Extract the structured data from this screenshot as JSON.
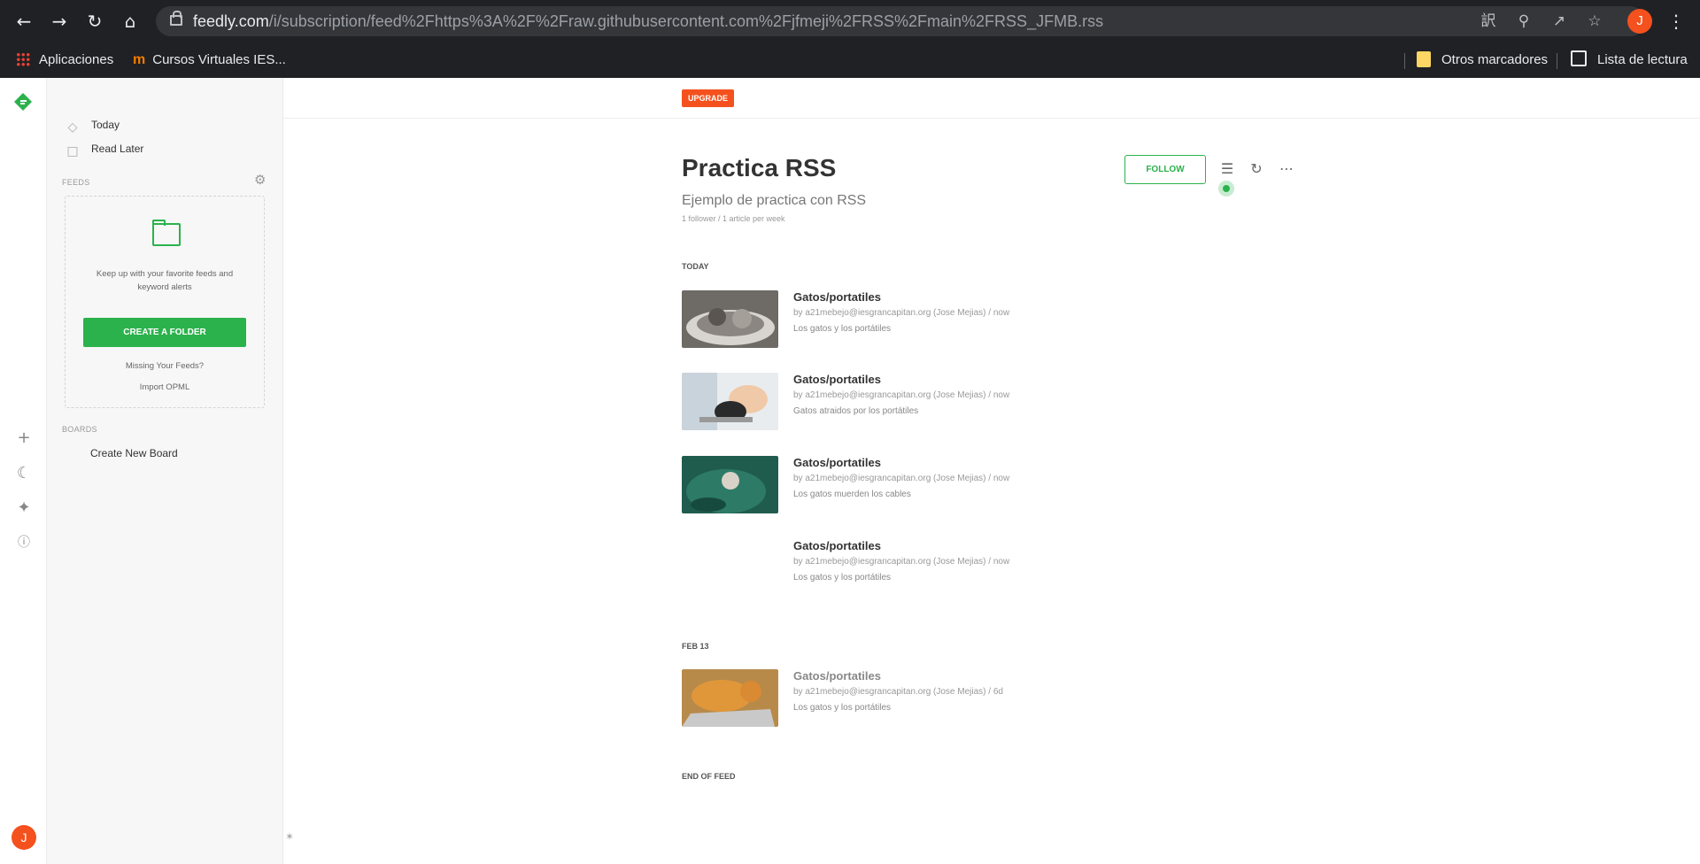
{
  "browser": {
    "url_host": "feedly.com",
    "url_path": "/i/subscription/feed%2Fhttps%3A%2F%2Fraw.githubusercontent.com%2Fjfmeji%2FRSS%2Fmain%2FRSS_JFMB.rss",
    "profile_initial": "J",
    "bookmarks": {
      "apps": "Aplicaciones",
      "cursos": "Cursos Virtuales IES...",
      "others": "Otros marcadores",
      "reading_list": "Lista de lectura"
    }
  },
  "rail": {
    "avatar_initial": "J",
    "icons": [
      "plus-icon",
      "moon-icon",
      "sparkle-icon",
      "help-icon"
    ]
  },
  "sidebar": {
    "today": "Today",
    "read_later": "Read Later",
    "feeds_label": "FEEDS",
    "empty_text": "Keep up with your favorite feeds and keyword alerts",
    "create_folder": "CREATE A FOLDER",
    "missing_feeds": "Missing Your Feeds?",
    "import_opml": "Import OPML",
    "boards_label": "BOARDS",
    "create_board": "Create New Board"
  },
  "main": {
    "upgrade": "UPGRADE",
    "title": "Practica RSS",
    "subtitle": "Ejemplo de practica con RSS",
    "stats": "1 follower / 1 article per week",
    "follow": "FOLLOW",
    "sections": {
      "today": "TODAY",
      "feb13": "FEB 13",
      "end": "END OF FEED"
    },
    "articles": [
      {
        "title": "Gatos/portatiles",
        "meta": "by a21mebejo@iesgrancapitan.org (Jose Mejias) / now",
        "summary": "Los gatos y los portátiles"
      },
      {
        "title": "Gatos/portatiles",
        "meta": "by a21mebejo@iesgrancapitan.org (Jose Mejias) / now",
        "summary": "Gatos atraidos por los portátiles"
      },
      {
        "title": "Gatos/portatiles",
        "meta": "by a21mebejo@iesgrancapitan.org (Jose Mejias) / now",
        "summary": "Los gatos muerden los cables"
      },
      {
        "title": "Gatos/portatiles",
        "meta": "by a21mebejo@iesgrancapitan.org (Jose Mejias) / now",
        "summary": "Los gatos y los portátiles"
      },
      {
        "title": "Gatos/portatiles",
        "meta": "by a21mebejo@iesgrancapitan.org (Jose Mejias) / 6d",
        "summary": "Los gatos y los portátiles"
      }
    ]
  },
  "colors": {
    "accent": "#2bb24c",
    "upgrade": "#f4511e",
    "chrome_bg": "#202124"
  }
}
